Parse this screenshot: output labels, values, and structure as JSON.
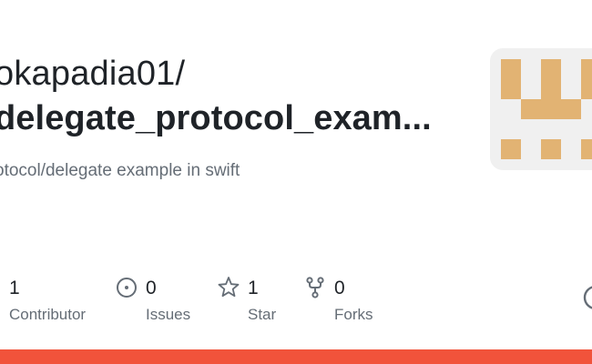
{
  "repo": {
    "owner": "okapadia01/",
    "name": "delegate_protocol_exam...",
    "description": "otocol/delegate example in swift"
  },
  "stats": [
    {
      "value": "1",
      "label": "Contributor",
      "icon": "contributors-icon"
    },
    {
      "value": "0",
      "label": "Issues",
      "icon": "issue-opened-icon"
    },
    {
      "value": "1",
      "label": "Star",
      "icon": "star-icon"
    },
    {
      "value": "0",
      "label": "Forks",
      "icon": "repo-forked-icon"
    }
  ],
  "colors": {
    "avatar_pattern": "#e2b373",
    "avatar_background": "#f0f0f0",
    "bottom_bar": "#f1533b",
    "icon_gray": "#656d76",
    "text_primary": "#1f2328",
    "text_secondary": "#656d76"
  }
}
